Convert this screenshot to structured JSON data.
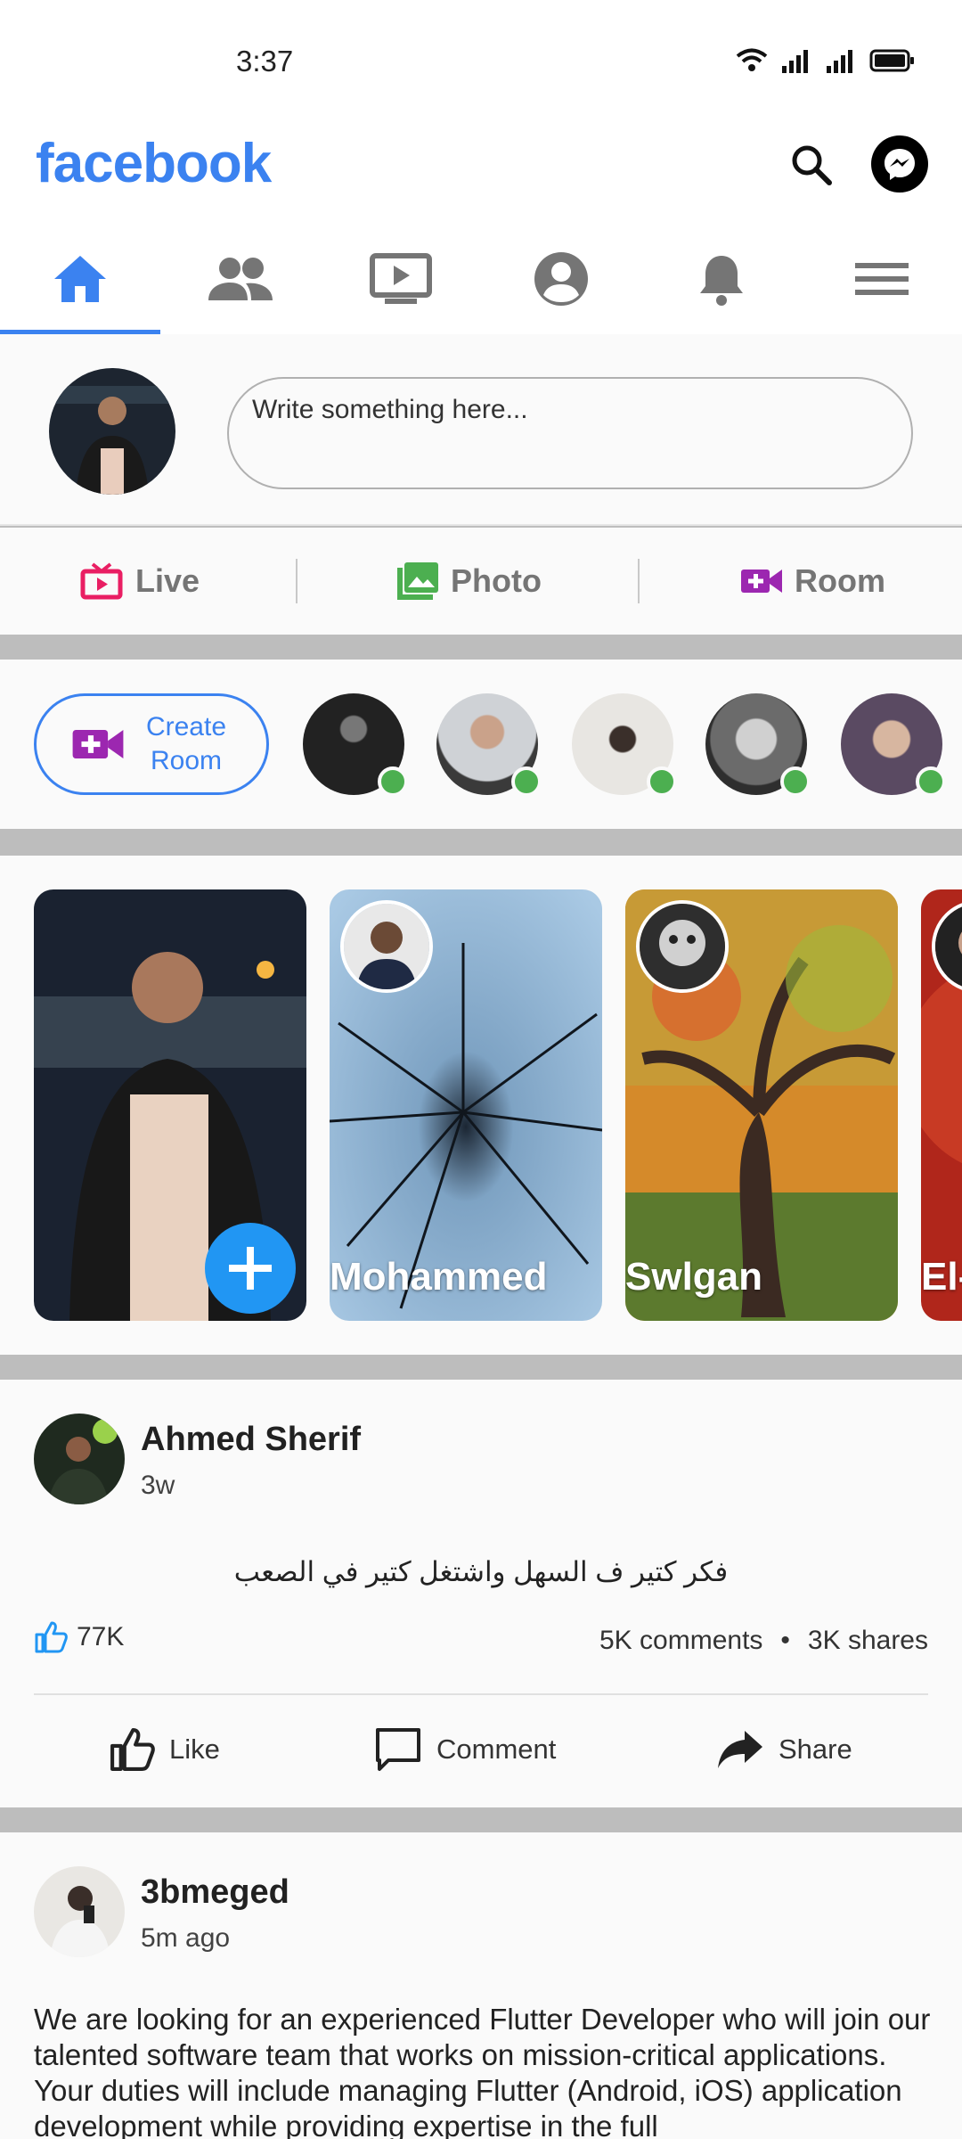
{
  "status": {
    "time": "3:37"
  },
  "app": {
    "brand": "facebook"
  },
  "tabs": [
    {
      "name": "home-icon",
      "active": true
    },
    {
      "name": "friends-icon",
      "active": false
    },
    {
      "name": "watch-icon",
      "active": false
    },
    {
      "name": "profile-icon",
      "active": false
    },
    {
      "name": "bell-icon",
      "active": false
    },
    {
      "name": "menu-icon",
      "active": false
    }
  ],
  "composer": {
    "placeholder": "Write something here..."
  },
  "actions": {
    "live": "Live",
    "photo": "Photo",
    "room": "Room"
  },
  "rooms": {
    "create_label": "Create Room"
  },
  "stories": [
    {
      "name": ""
    },
    {
      "name": "Mohammed"
    },
    {
      "name": "Swlgan"
    },
    {
      "name": "El-"
    }
  ],
  "post1": {
    "author": "Ahmed Sherif",
    "time": "3w",
    "text": "فكر كتير ف السهل واشتغل كتير في الصعب",
    "likes": "77K",
    "comments": "5K comments",
    "bullet": "•",
    "shares": "3K shares",
    "like_label": "Like",
    "comment_label": "Comment",
    "share_label": "Share"
  },
  "post2": {
    "author": "3bmeged",
    "time": "5m ago",
    "text": "We are looking for an experienced Flutter Developer who will join our talented software team that works on mission-critical applications. Your duties will include managing Flutter (Android, iOS) application development while providing expertise in the full"
  },
  "colors": {
    "brand": "#3b82f0",
    "live": "#e91e63",
    "photo": "#4caf50",
    "room": "#9c27b0",
    "online": "#4caf50"
  }
}
